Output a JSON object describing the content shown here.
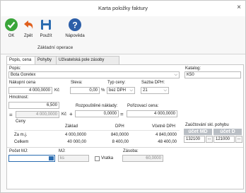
{
  "window": {
    "title": "Karta položky faktury",
    "close": "×"
  },
  "ribbon": {
    "ok": "OK",
    "back": "Zpět",
    "use": "Použít",
    "help": "Nápověda",
    "group": "Základní operace"
  },
  "tabs": [
    "Popis, cena",
    "Pohyby",
    "Uživatelská pole zásoby"
  ],
  "form": {
    "popis_label": "Popis:",
    "popis_value": "Bota Goretex",
    "katalog_label": "Katalog:",
    "katalog_value": "K50",
    "nakupni_label": "Nákupní cena",
    "nakupni_value": "4 000,0000",
    "nakupni_currency": "Kč",
    "sleva_label": "Sleva:",
    "sleva_value": "0,00",
    "sleva_unit": "%",
    "typ_label": "Typ ceny:",
    "typ_value": "bez DPH",
    "sazba_label": "Sazba DPH:",
    "sazba_value": "21",
    "hmotnost_label": "Hmotnost:",
    "hmotnost_value": "6,500",
    "eq": "=",
    "plus": "+",
    "calc_value": "4 000,0000",
    "calc_currency": "Kč",
    "rozp_label": "Rozpouštěné náklady:",
    "rozp_value": "0,0000",
    "poriz_label": "Pořizovací cena:",
    "poriz_value": "4 000,0000",
    "zauct_label": "Zaúčtování skl. pohybu",
    "ucet_md": "účet MD",
    "ucet_d": "účet D",
    "md_value": "132100",
    "d_value": "121000",
    "dots": "...",
    "pocet_label": "Počet MJ:",
    "mj_label": "MJ:",
    "mj_value": "ks",
    "vratka_label": "Vratka",
    "zasoba_label": "Zásoba:",
    "zasoba_value": "60,0000"
  },
  "prices": {
    "title": "Ceny",
    "headers": [
      "Základ",
      "DPH",
      "Včetně DPH"
    ],
    "rows": [
      {
        "label": "Za m.j.",
        "zaklad": "4 000,0000",
        "dph": "840,0000",
        "vcetne": "4 840,0000"
      },
      {
        "label": "Celkem",
        "zaklad": "40 000,00",
        "dph": "8 400,00",
        "vcetne": "48 400,00"
      }
    ]
  },
  "colors": {
    "ok": "#3aa53a",
    "back": "#e0601e",
    "save": "#2b6cb0",
    "help": "#2c5ea8"
  }
}
